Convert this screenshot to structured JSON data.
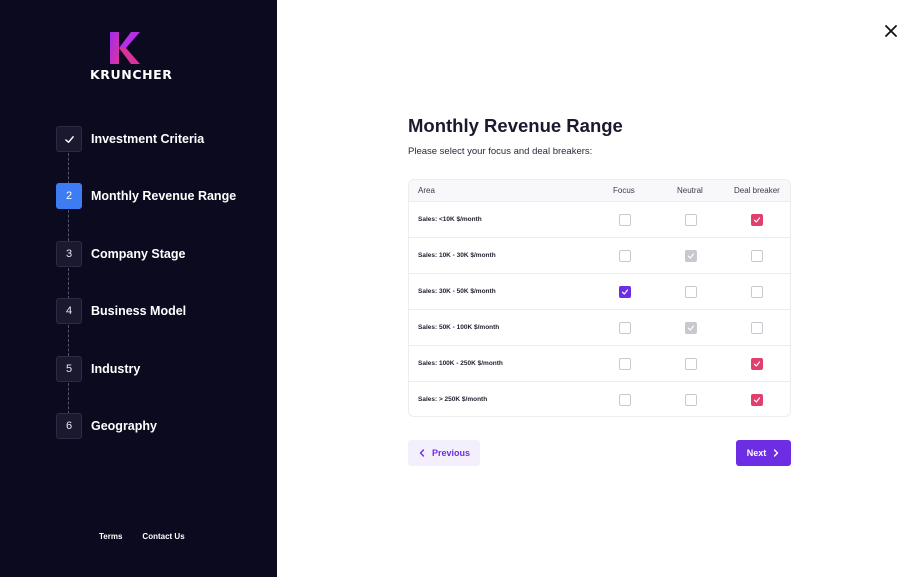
{
  "brand": {
    "name": "KRUNCHER",
    "colors": {
      "logo_top": "#a02cf0",
      "logo_bottom": "#e0339a"
    }
  },
  "sidebar": {
    "steps": [
      {
        "marker": "",
        "icon": "check-icon",
        "label": "Investment Criteria",
        "state": "done"
      },
      {
        "marker": "2",
        "label": "Monthly Revenue Range",
        "state": "active"
      },
      {
        "marker": "3",
        "label": "Company Stage",
        "state": "pending"
      },
      {
        "marker": "4",
        "label": "Business Model",
        "state": "pending"
      },
      {
        "marker": "5",
        "label": "Industry",
        "state": "pending"
      },
      {
        "marker": "6",
        "label": "Geography",
        "state": "pending"
      }
    ],
    "footer": {
      "terms": "Terms",
      "contact": "Contact Us"
    }
  },
  "main": {
    "title": "Monthly Revenue Range",
    "subtitle": "Please select your focus and deal breakers:",
    "table": {
      "headers": {
        "area": "Area",
        "focus": "Focus",
        "neutral": "Neutral",
        "deal": "Deal breaker"
      },
      "rows": [
        {
          "area": "Sales: <10K $/month",
          "selection": "deal"
        },
        {
          "area": "Sales: 10K - 30K $/month",
          "selection": "neutral"
        },
        {
          "area": "Sales: 30K - 50K $/month",
          "selection": "focus"
        },
        {
          "area": "Sales: 50K - 100K $/month",
          "selection": "neutral"
        },
        {
          "area": "Sales: 100K - 250K $/month",
          "selection": "deal"
        },
        {
          "area": "Sales: > 250K $/month",
          "selection": "deal"
        }
      ]
    },
    "buttons": {
      "previous": "Previous",
      "next": "Next"
    }
  },
  "colors": {
    "sidebar_bg": "#0b0a1f",
    "active_step": "#3d7df4",
    "accent": "#6d2ee3",
    "focus_check": "#6d2ee3",
    "neutral_check": "#c8c8cf",
    "deal_check": "#e23f6c"
  }
}
